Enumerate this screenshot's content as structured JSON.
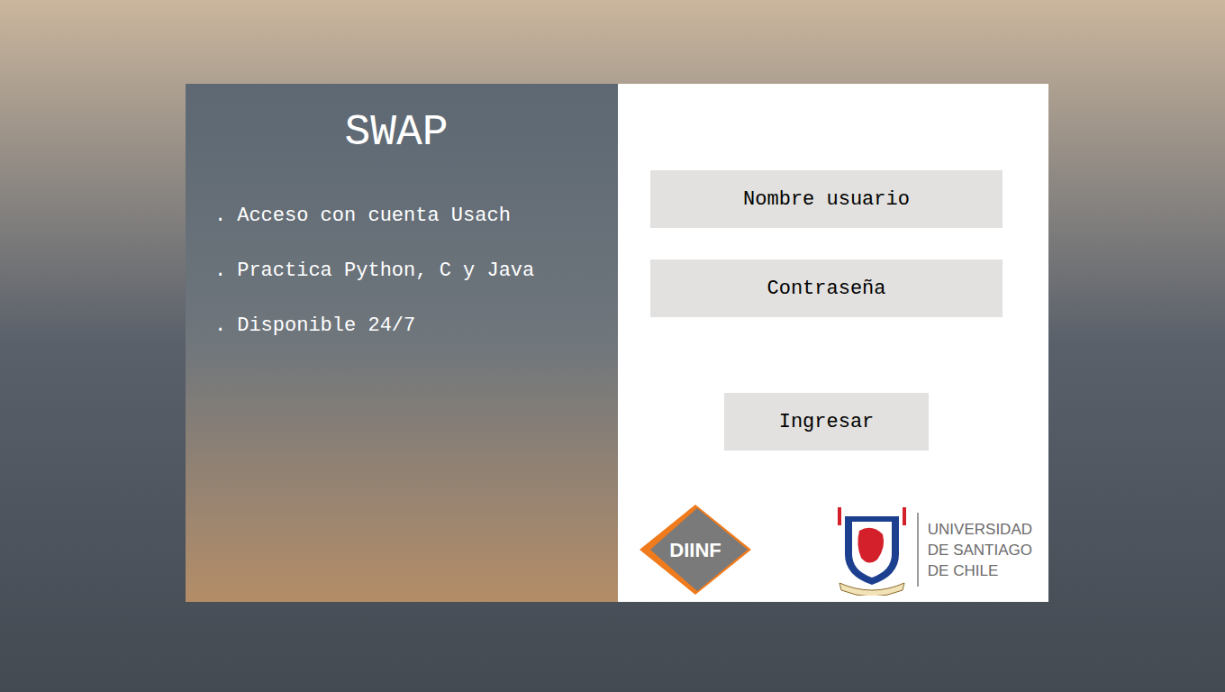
{
  "app": {
    "title": "SWAP"
  },
  "features": [
    {
      "bullet": ".",
      "text": "Acceso con cuenta Usach"
    },
    {
      "bullet": ".",
      "text": "Practica Python, C y Java"
    },
    {
      "bullet": ".",
      "text": "Disponible 24/7"
    }
  ],
  "form": {
    "fields": [
      {
        "placeholder": "Nombre usuario"
      },
      {
        "placeholder": "Contraseña"
      }
    ],
    "submit": "Ingresar"
  },
  "logos": {
    "diinf": "DIINF",
    "university": [
      "UNIVERSIDAD",
      "DE SANTIAGO",
      "DE CHILE"
    ]
  }
}
